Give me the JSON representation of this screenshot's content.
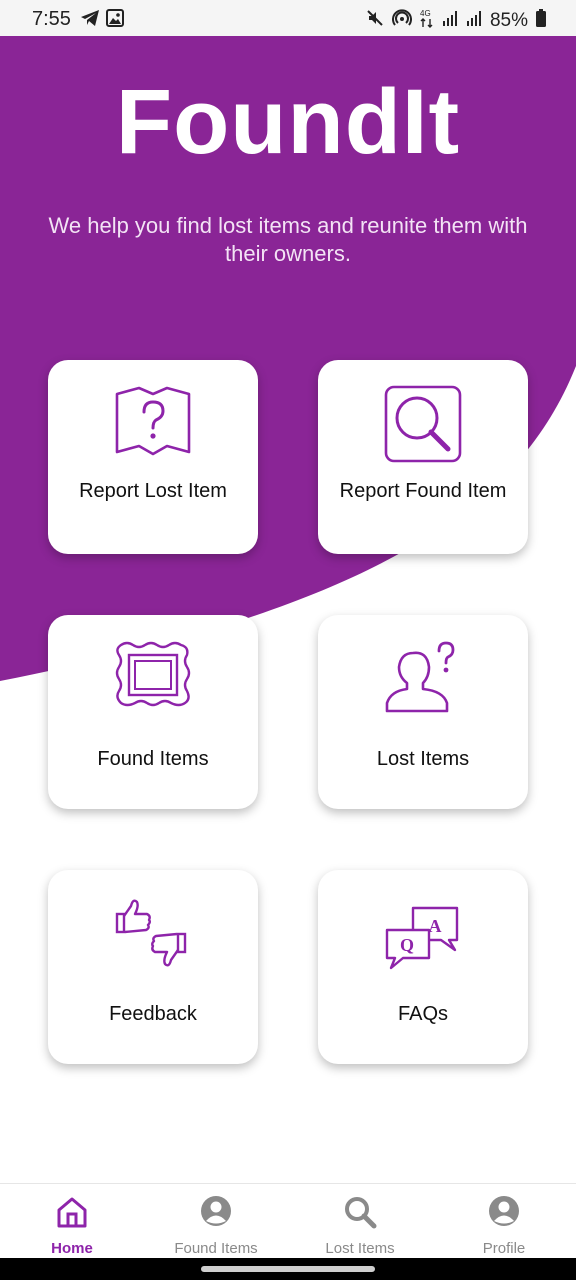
{
  "status_bar": {
    "time": "7:55",
    "left_icons": [
      "telegram-icon",
      "gallery-icon"
    ],
    "right_icons": [
      "mute-icon",
      "hotspot-icon",
      "network-4g-icon",
      "signal-icon",
      "signal-icon",
      "battery-icon"
    ],
    "battery": "85%"
  },
  "hero": {
    "title": "FoundIt",
    "tagline": "We help you find lost items and reunite them with their owners."
  },
  "colors": {
    "brand": "#8A2596",
    "icon_purple": "#8E24AA",
    "nav_inactive": "#8a8a8a"
  },
  "cards": {
    "report_lost": {
      "label": "Report Lost Item",
      "icon": "map-question-icon"
    },
    "report_found": {
      "label": "Report Found Item",
      "icon": "magnifier-icon"
    },
    "found_items": {
      "label": "Found Items",
      "icon": "picture-frame-icon"
    },
    "lost_items": {
      "label": "Lost Items",
      "icon": "person-question-icon"
    },
    "feedback": {
      "label": "Feedback",
      "icon": "thumbs-icon"
    },
    "faqs": {
      "label": "FAQs",
      "icon": "qa-bubbles-icon",
      "q": "Q",
      "a": "A"
    }
  },
  "bottom_nav": {
    "home": {
      "label": "Home",
      "icon": "home-icon",
      "active": true
    },
    "found_items": {
      "label": "Found Items",
      "icon": "user-circle-icon"
    },
    "lost_items": {
      "label": "Lost Items",
      "icon": "search-icon"
    },
    "profile": {
      "label": "Profile",
      "icon": "user-circle-icon"
    }
  }
}
